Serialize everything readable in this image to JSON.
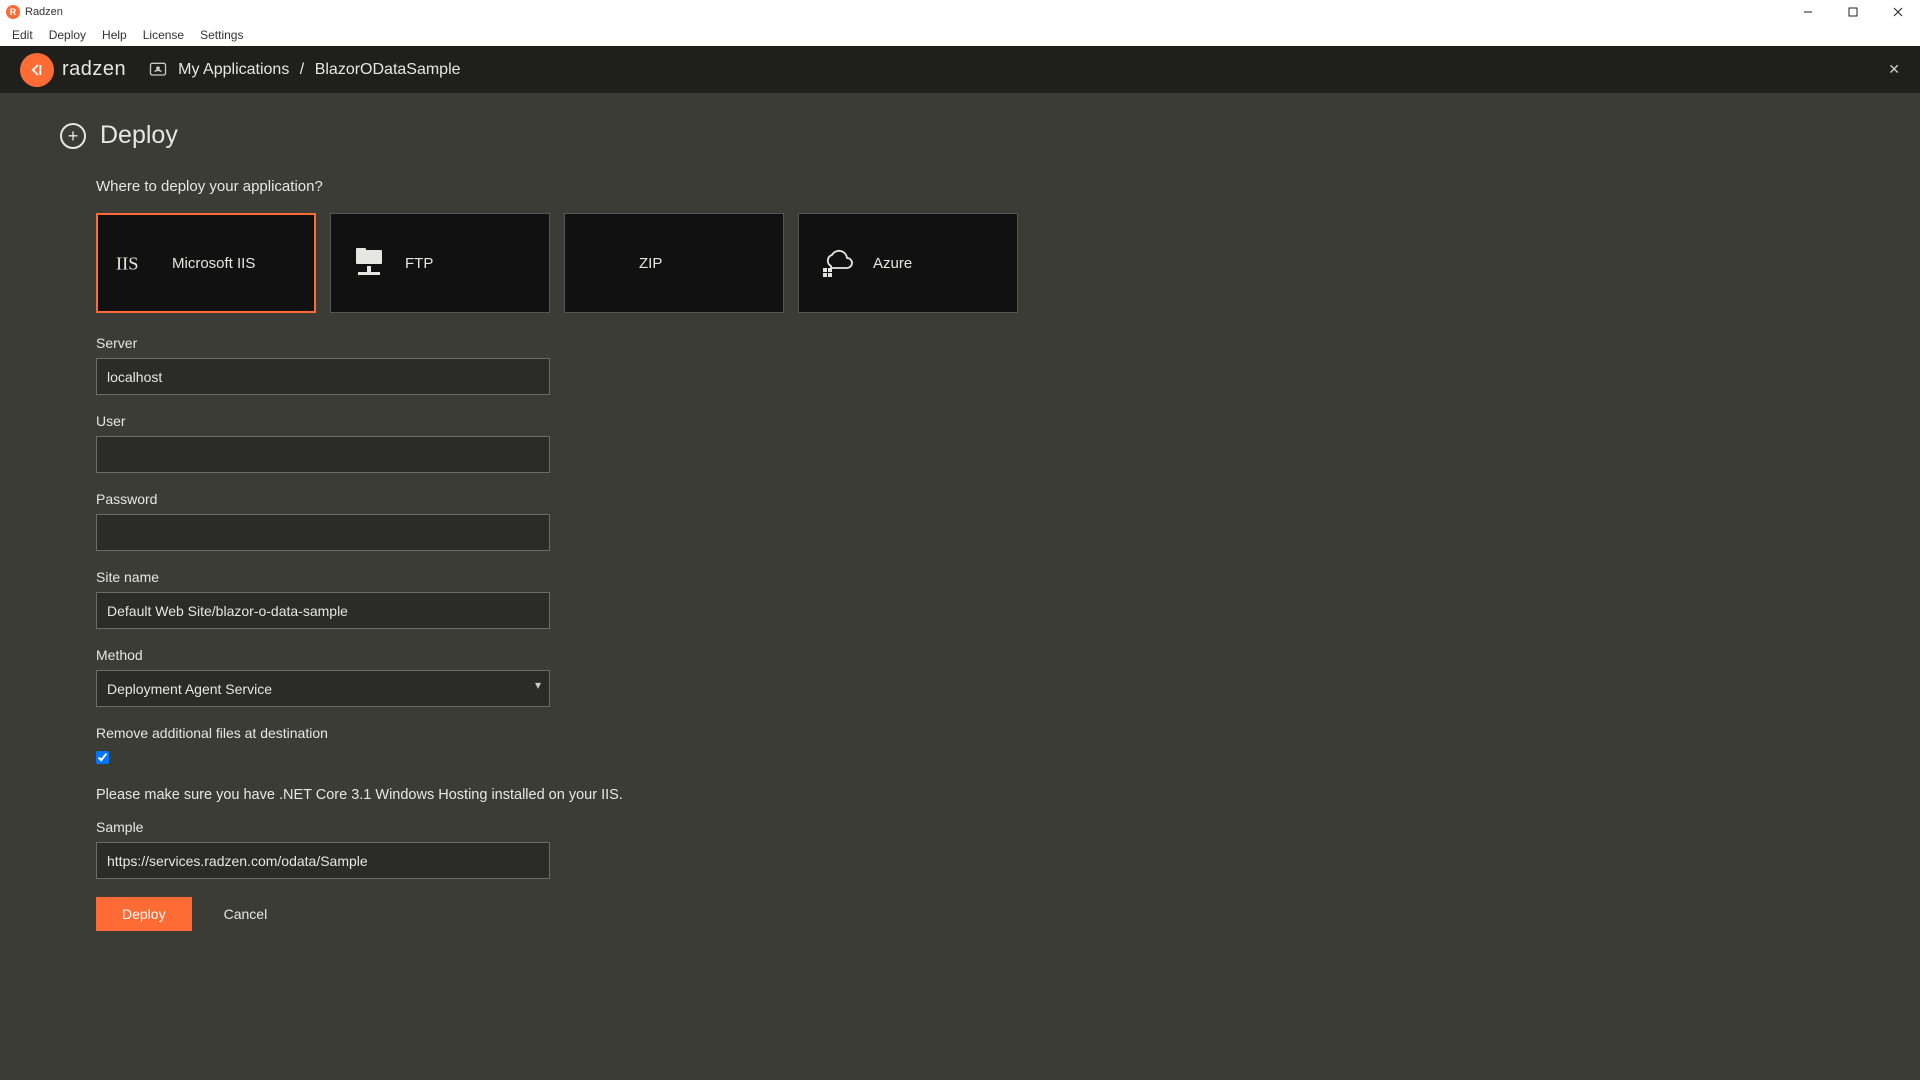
{
  "window": {
    "title": "Radzen"
  },
  "menubar": [
    "Edit",
    "Deploy",
    "Help",
    "License",
    "Settings"
  ],
  "header": {
    "brand": "radzen",
    "breadcrumb_root": "My Applications",
    "breadcrumb_sep": "/",
    "breadcrumb_current": "BlazorODataSample"
  },
  "page": {
    "title": "Deploy",
    "question": "Where to deploy your application?"
  },
  "targets": [
    {
      "label": "Microsoft IIS",
      "icon": "iis"
    },
    {
      "label": "FTP",
      "icon": "ftp"
    },
    {
      "label": "ZIP",
      "icon": "zip"
    },
    {
      "label": "Azure",
      "icon": "azure"
    }
  ],
  "form": {
    "server_label": "Server",
    "server_value": "localhost",
    "user_label": "User",
    "user_value": "",
    "password_label": "Password",
    "password_value": "",
    "site_label": "Site name",
    "site_value": "Default Web Site/blazor-o-data-sample",
    "method_label": "Method",
    "method_value": "Deployment Agent Service",
    "remove_label": "Remove additional files at destination",
    "remove_checked": true,
    "hint": "Please make sure you have .NET Core 3.1 Windows Hosting installed on your IIS.",
    "sample_label": "Sample",
    "sample_value": "https://services.radzen.com/odata/Sample",
    "deploy_btn": "Deploy",
    "cancel_btn": "Cancel"
  }
}
